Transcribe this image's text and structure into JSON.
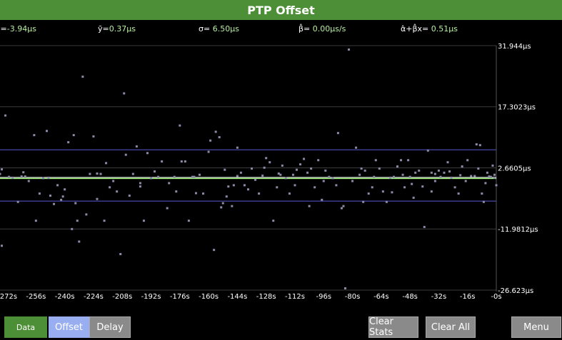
{
  "title": "PTP Offset",
  "stats": {
    "mean_label": "ȳ=",
    "mean_value": "-3.94µs",
    "median_label": "ỹ=",
    "median_value": "0.37µs",
    "sigma_label": "σ=",
    "sigma_value": "6.50µs",
    "beta_label": "β̂=",
    "beta_value": "0.00µs/s",
    "fit_label": "α̂+β̂x=",
    "fit_value": "0.51µs"
  },
  "colors": {
    "title_bg": "#4d8f37",
    "point": "#8a8aa8",
    "sigma_band": "#5a5ad0",
    "mean_line": "#ffffff",
    "fit_line": "#9cf07a",
    "grid": "#3a3a3a",
    "stat_value": "#b8f0a0"
  },
  "chart_data": {
    "type": "scatter",
    "xlim": [
      -276,
      0
    ],
    "ylim": [
      -26.623,
      31.944
    ],
    "xticks": [
      "-272s",
      "-256s",
      "-240s",
      "-224s",
      "-208s",
      "-192s",
      "-176s",
      "-160s",
      "-144s",
      "-128s",
      "-112s",
      "-96s",
      "-80s",
      "-64s",
      "-48s",
      "-32s",
      "-16s",
      "-0s"
    ],
    "xtick_values": [
      -272,
      -256,
      -240,
      -224,
      -208,
      -192,
      -176,
      -160,
      -144,
      -128,
      -112,
      -96,
      -80,
      -64,
      -48,
      -32,
      -16,
      0
    ],
    "yticks": [
      "31.944µs",
      "17.3023µs",
      "2.6605µs",
      "-11.9812µs",
      "-26.623µs"
    ],
    "ytick_values": [
      31.944,
      17.3023,
      2.6605,
      -11.9812,
      -26.623
    ],
    "mean": 0.37,
    "sigma_band": [
      -5.3,
      7.0
    ],
    "fit": {
      "alpha": 0.37,
      "beta": 0.0
    },
    "points": [
      [
        -276,
        1.2
      ],
      [
        -275,
        -16
      ],
      [
        -273,
        15.2
      ],
      [
        -271,
        0.5
      ],
      [
        -269,
        0.3
      ],
      [
        -266,
        -5.5
      ],
      [
        -264,
        0.6
      ],
      [
        -262,
        0.6
      ],
      [
        -260,
        -0.5
      ],
      [
        -257,
        10.5
      ],
      [
        -256,
        -10
      ],
      [
        -254,
        -3.5
      ],
      [
        -252,
        0.2
      ],
      [
        -250,
        11.5
      ],
      [
        -248,
        -4
      ],
      [
        -246,
        -6
      ],
      [
        -244,
        -1.5
      ],
      [
        -242,
        -5
      ],
      [
        -240,
        -2.5
      ],
      [
        -238,
        8.8
      ],
      [
        -236,
        -12
      ],
      [
        -235,
        10.5
      ],
      [
        -233,
        -10
      ],
      [
        -232,
        -15
      ],
      [
        -230,
        24.5
      ],
      [
        -228,
        -8.5
      ],
      [
        -226,
        1.2
      ],
      [
        -224,
        10.2
      ],
      [
        -222,
        -4.8
      ],
      [
        -220,
        1.2
      ],
      [
        -218,
        -10
      ],
      [
        -217,
        3.8
      ],
      [
        -215,
        -2
      ],
      [
        -213,
        -0.5
      ],
      [
        -211,
        -3
      ],
      [
        -209,
        -18
      ],
      [
        -207,
        20.5
      ],
      [
        -206,
        5.8
      ],
      [
        -204,
        -4
      ],
      [
        -202,
        1.2
      ],
      [
        -200,
        7.8
      ],
      [
        -198,
        -1.8
      ],
      [
        -196,
        -10
      ],
      [
        -194,
        6.2
      ],
      [
        -192,
        0.2
      ],
      [
        -190,
        1.8
      ],
      [
        -188,
        0.5
      ],
      [
        -186,
        4.2
      ],
      [
        -183,
        -7
      ],
      [
        -182,
        -1
      ],
      [
        -179,
        0.5
      ],
      [
        -176,
        12.8
      ],
      [
        -175,
        4.2
      ],
      [
        -173,
        4.2
      ],
      [
        -171,
        -10
      ],
      [
        -169,
        0.5
      ],
      [
        -168,
        0.5
      ],
      [
        -165,
        1
      ],
      [
        -163,
        -3.5
      ],
      [
        -160,
        6.5
      ],
      [
        -159,
        9.2
      ],
      [
        -157,
        -17
      ],
      [
        -156,
        11.3
      ],
      [
        -154,
        10
      ],
      [
        -153,
        -6.8
      ],
      [
        -151,
        2.2
      ],
      [
        -149,
        -1.8
      ],
      [
        -147,
        -6.5
      ],
      [
        -146,
        -1.5
      ],
      [
        -144,
        7.5
      ],
      [
        -142,
        1.5
      ],
      [
        -140,
        -1.5
      ],
      [
        -138,
        -2.5
      ],
      [
        -136,
        2.5
      ],
      [
        -134,
        -0.2
      ],
      [
        -132,
        -3.5
      ],
      [
        -130,
        0.8
      ],
      [
        -128,
        5
      ],
      [
        -126,
        4
      ],
      [
        -124,
        -10
      ],
      [
        -122,
        -2
      ],
      [
        -120,
        1
      ],
      [
        -119,
        3.2
      ],
      [
        -117,
        0.2
      ],
      [
        -115,
        -3.5
      ],
      [
        -113,
        1
      ],
      [
        -111,
        2.2
      ],
      [
        -109,
        3.5
      ],
      [
        -107,
        4.8
      ],
      [
        -105,
        1.5
      ],
      [
        -103,
        2.5
      ],
      [
        -101,
        -2
      ],
      [
        -99,
        4.5
      ],
      [
        -97,
        -5
      ],
      [
        -95,
        2
      ],
      [
        -93,
        0.5
      ],
      [
        -91,
        0.2
      ],
      [
        -89,
        -1.5
      ],
      [
        -88,
        11
      ],
      [
        -86,
        -7
      ],
      [
        -85,
        -6.5
      ],
      [
        -84,
        -26.2
      ],
      [
        -82,
        31
      ],
      [
        -80,
        -0.5
      ],
      [
        -78,
        7.5
      ],
      [
        -76,
        1
      ],
      [
        -74,
        -5.5
      ],
      [
        -73,
        2
      ],
      [
        -71,
        -3.5
      ],
      [
        -69,
        -2
      ],
      [
        -67,
        4.5
      ],
      [
        -65,
        2.5
      ],
      [
        -63,
        -3
      ],
      [
        -61,
        -5.5
      ],
      [
        -59,
        0.3
      ],
      [
        -57,
        0.5
      ],
      [
        -55,
        3
      ],
      [
        -53,
        4.5
      ],
      [
        -51,
        -2
      ],
      [
        -49,
        4.5
      ],
      [
        -48,
        0.5
      ],
      [
        -46,
        -4.5
      ],
      [
        -45,
        1.5
      ],
      [
        -43,
        2
      ],
      [
        -41,
        -1.8
      ],
      [
        -40,
        -11.5
      ],
      [
        -38,
        6.8
      ],
      [
        -36,
        -3
      ],
      [
        -34,
        -0.5
      ],
      [
        -32,
        2
      ],
      [
        -31,
        0.5
      ],
      [
        -29,
        1.5
      ],
      [
        -27,
        4
      ],
      [
        -25,
        0.3
      ],
      [
        -23,
        -2
      ],
      [
        -21,
        -3.5
      ],
      [
        -19,
        3
      ],
      [
        -17,
        -0.5
      ],
      [
        -16,
        4.5
      ],
      [
        -14,
        0.7
      ],
      [
        -12,
        0.7
      ],
      [
        -10,
        2.5
      ],
      [
        -8,
        -3.5
      ],
      [
        -6,
        -1
      ],
      [
        -5,
        1.5
      ],
      [
        -3,
        0.5
      ],
      [
        -2,
        3.2
      ],
      [
        -1,
        1
      ],
      [
        0,
        -1.5
      ],
      [
        -275,
        2.3
      ],
      [
        -222,
        1.3
      ],
      [
        -234,
        -5.8
      ],
      [
        -178,
        -3
      ],
      [
        -150,
        -4.2
      ],
      [
        -144,
        0.7
      ],
      [
        -129,
        2.7
      ],
      [
        -112,
        -1.5
      ],
      [
        -96,
        -0.5
      ],
      [
        -75,
        2.5
      ],
      [
        -68,
        0.5
      ],
      [
        -52,
        1
      ],
      [
        -47,
        -1.2
      ],
      [
        -34,
        1.2
      ],
      [
        -20,
        0.9
      ],
      [
        -11,
        8.3
      ],
      [
        -9,
        8.1
      ],
      [
        -7,
        -5.5
      ],
      [
        -4,
        0.6
      ],
      [
        -1,
        0.3
      ],
      [
        -26,
        1.8
      ],
      [
        -263,
        1.6
      ],
      [
        -249,
        0.3
      ],
      [
        -241,
        -4.2
      ],
      [
        -198,
        -1
      ],
      [
        -167,
        -3.4
      ],
      [
        -152,
        -5.8
      ],
      [
        -121,
        1.3
      ],
      [
        -104,
        -6.5
      ],
      [
        -58,
        -3.2
      ],
      [
        -36,
        1.5
      ]
    ]
  },
  "buttons": {
    "data": "Data",
    "offset": "Offset",
    "delay": "Delay",
    "clear_stats": "Clear Stats",
    "clear_all": "Clear All",
    "menu": "Menu"
  }
}
